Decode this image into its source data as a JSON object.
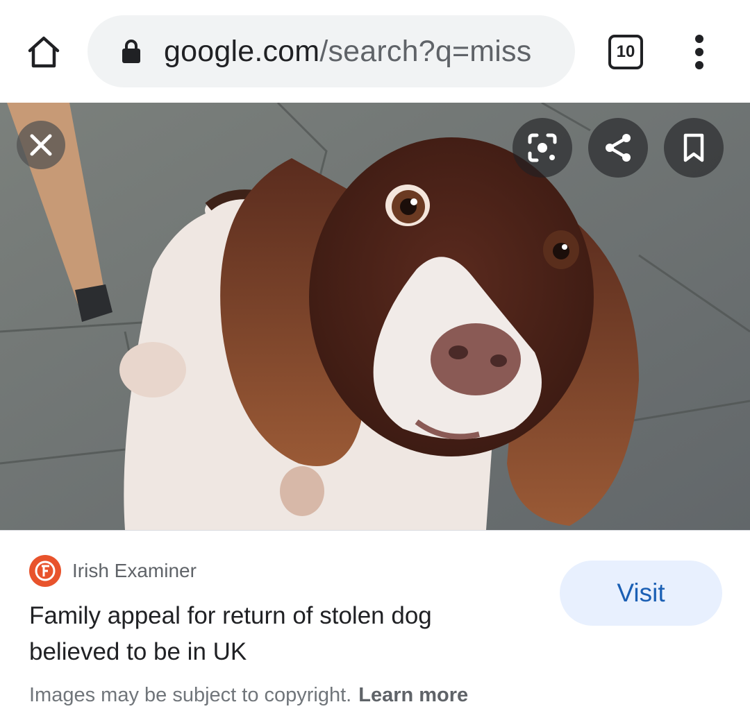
{
  "browser": {
    "url_domain": "google.com",
    "url_path": "/search?q=miss",
    "tab_count": "10",
    "icons": [
      "home-icon",
      "lock-icon",
      "tabs-icon",
      "more-vert-icon"
    ]
  },
  "image_viewer": {
    "image_subject": "photo",
    "icons": [
      "close-icon",
      "lens-icon",
      "share-icon",
      "bookmark-icon"
    ]
  },
  "result": {
    "source": "Irish Examiner",
    "title": "Family appeal for return of stolen dog believed to be in UK",
    "visit_label": "Visit"
  },
  "footer": {
    "copyright_text": "Images may be subject to copyright.",
    "learn_more": "Learn more"
  },
  "colors": {
    "accent_blue": "#1a5fb4",
    "visit_bg": "#e8f0fe",
    "favicon_orange": "#e8532c",
    "url_bar_bg": "#f1f3f4"
  }
}
